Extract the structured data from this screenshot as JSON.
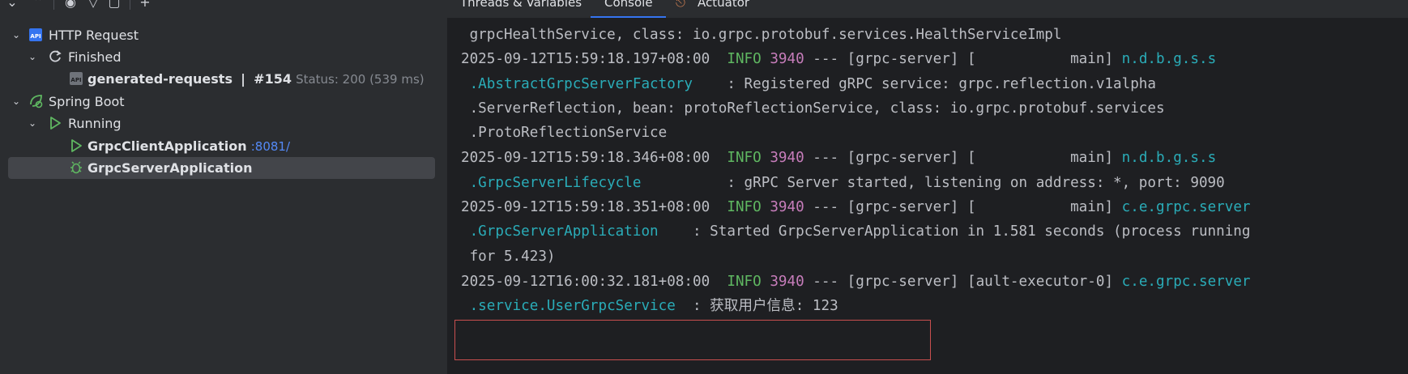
{
  "services_tree": {
    "rows": [
      {
        "label": "HTTP Request"
      },
      {
        "label": "Finished"
      },
      {
        "label": "generated-requests",
        "separator": "|",
        "number": "#154",
        "status": "Status: 200 (539 ms)"
      },
      {
        "label": "Spring Boot"
      },
      {
        "label": "Running"
      },
      {
        "label": "GrpcClientApplication",
        "port": ":8081/"
      },
      {
        "label": "GrpcServerApplication"
      }
    ]
  },
  "tabs": [
    {
      "label": "Threads & Variables"
    },
    {
      "label": "Console",
      "active": true
    },
    {
      "label": "Actuator"
    }
  ],
  "console": {
    "lines": [
      {
        "text": " grpcHealthService, class: io.grpc.protobuf.services.HealthServiceImpl"
      },
      {
        "ts": "2025-09-12T15:59:18.197+08:00",
        "level": "INFO",
        "pid": "3940",
        "rest": " --- [grpc-server] [           main] ",
        "logger": "n.d.b.g.s.s"
      },
      {
        "logger": " .AbstractGrpcServerFactory",
        "rest": "    : Registered gRPC service: grpc.reflection.v1alpha"
      },
      {
        "text": " .ServerReflection, bean: protoReflectionService, class: io.grpc.protobuf.services"
      },
      {
        "text": " .ProtoReflectionService"
      },
      {
        "ts": "2025-09-12T15:59:18.346+08:00",
        "level": "INFO",
        "pid": "3940",
        "rest": " --- [grpc-server] [           main] ",
        "logger": "n.d.b.g.s.s"
      },
      {
        "logger": " .GrpcServerLifecycle",
        "rest": "          : gRPC Server started, listening on address: *, port: 9090"
      },
      {
        "ts": "2025-09-12T15:59:18.351+08:00",
        "level": "INFO",
        "pid": "3940",
        "rest": " --- [grpc-server] [           main] ",
        "logger": "c.e.grpc.server"
      },
      {
        "logger": " .GrpcServerApplication",
        "rest": "    : Started GrpcServerApplication in 1.581 seconds (process running"
      },
      {
        "text": " for 5.423)"
      },
      {
        "ts": "2025-09-12T16:00:32.181+08:00",
        "level": "INFO",
        "pid": "3940",
        "rest": " --- [grpc-server] [ault-executor-0] ",
        "logger": "c.e.grpc.server"
      },
      {
        "logger": " .service.UserGrpcService",
        "rest": "  : 获取用户信息: 123"
      }
    ]
  },
  "colors": {
    "info": "#5fb761",
    "pid": "#c77dbb",
    "logger": "#2aacb8",
    "highlight": "#c94f4f",
    "selection": "#43454a"
  }
}
